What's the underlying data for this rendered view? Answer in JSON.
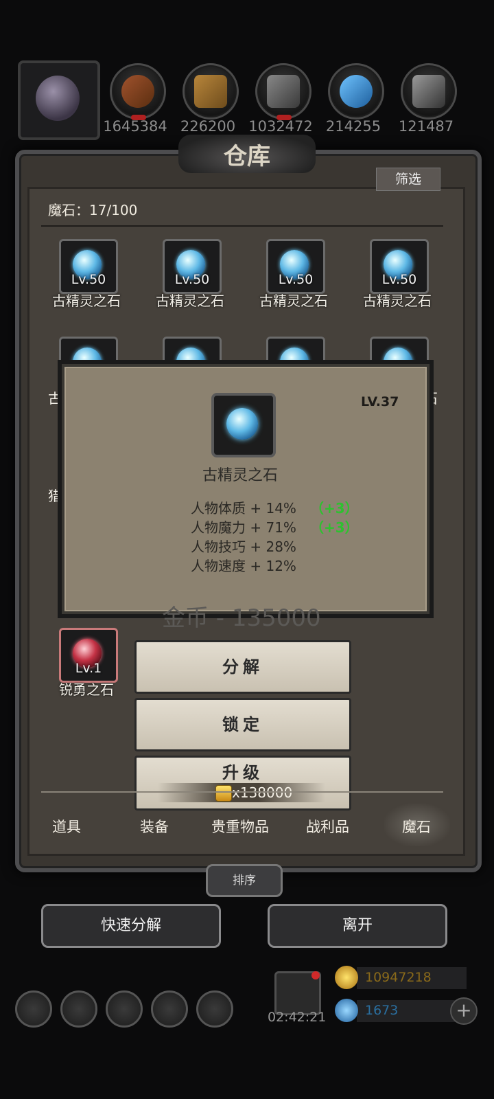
{
  "resources": {
    "values": [
      "1645384",
      "226200",
      "1032472",
      "214255",
      "121487"
    ]
  },
  "warehouse": {
    "title": "仓库",
    "filter_label": "筛选",
    "count_label": "魔石：17/100"
  },
  "grid_items": [
    {
      "level": "Lv.50",
      "name": "古精灵之石"
    },
    {
      "level": "Lv.50",
      "name": "古精灵之石"
    },
    {
      "level": "Lv.50",
      "name": "古精灵之石"
    },
    {
      "level": "Lv.50",
      "name": "古精灵之石"
    }
  ],
  "partial_items": {
    "left_fragment": "古",
    "right_fragment": "石",
    "left_fragment_2": "猎"
  },
  "tooltip": {
    "level": "LV.37",
    "name": "古精灵之石",
    "stats": [
      {
        "text": "人物体质 + 14%",
        "bonus": "（+3）"
      },
      {
        "text": "人物魔力 + 71%",
        "bonus": "（+3）"
      },
      {
        "text": "人物技巧 + 28%",
        "bonus": ""
      },
      {
        "text": "人物速度 + 12%",
        "bonus": ""
      }
    ],
    "gold_ghost": "金币 - 135000"
  },
  "selected_item": {
    "level": "Lv.1",
    "name": "锐勇之石"
  },
  "actions": {
    "decompose": "分解",
    "lock": "锁定",
    "upgrade": "升级",
    "upgrade_cost": "x138000"
  },
  "tabs": [
    "道具",
    "装备",
    "贵重物品",
    "战利品",
    "魔石"
  ],
  "active_tab": "魔石",
  "sort_label": "排序",
  "quick_decompose": "快速分解",
  "leave": "离开",
  "hud": {
    "timer": "02:42:21",
    "gold": "10947218",
    "gems": "1673",
    "gold_color": "#8a6a1a",
    "gem_color": "#2a6fa0"
  }
}
